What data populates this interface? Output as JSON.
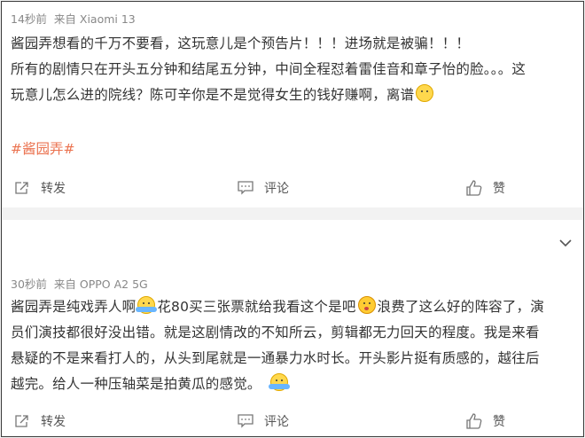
{
  "posts": [
    {
      "time": "14秒前",
      "source": "来自 Xiaomi 13",
      "lines": [
        "酱园弄想看的千万不要看，这玩意儿是个预告片！！！进场就是被骗！！！",
        "所有的剧情只在开头五分钟和结尾五分钟，中间全程怼着雷佳音和章子怡的脸。。。这",
        "玩意儿怎么进的院线？陈可辛你是不是觉得女生的钱好赚啊，离谱"
      ],
      "hashtag": "#酱园弄#",
      "actions": {
        "repost": "转发",
        "comment": "评论",
        "like": "赞"
      }
    },
    {
      "time": "30秒前",
      "source": "来自 OPPO A2 5G",
      "lines": [
        "酱园弄是纯戏弄人啊",
        "花80买三张票就给我看这个是吧",
        "浪费了这么好的阵容了，演",
        "员们演技都很好没出错。就是这剧情改的不知所云，剪辑都无力回天的程度。我是来看",
        "悬疑的不是来看打人的，从头到尾就是一通暴力水时长。开头影片挺有质感的，越往后",
        "越完。给人一种压轴菜是拍黄瓜的感觉。"
      ],
      "actions": {
        "repost": "转发",
        "comment": "评论",
        "like": "赞"
      }
    }
  ],
  "icons": {
    "emoji_1": "thinking-emoji-icon",
    "emoji_2": "hug-emoji-icon",
    "emoji_3": "shocked-emoji-icon",
    "expand": "chevron-down-icon"
  },
  "colors": {
    "hashtag": "#eb7350",
    "meta": "#888888",
    "text": "#333333"
  }
}
